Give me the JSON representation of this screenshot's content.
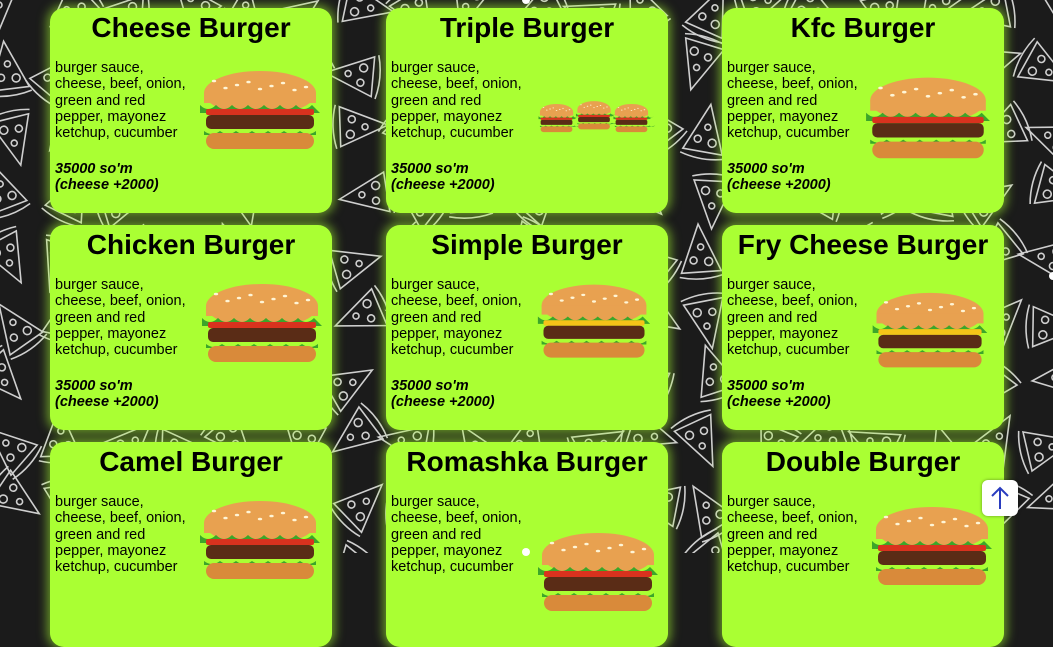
{
  "menu": {
    "items": [
      {
        "name": "Cheese Burger",
        "desc": "burger sauce, cheese, beef, onion, green and red pepper, mayonez ketchup, cucumber",
        "price": "35000 so'm",
        "extra": "(cheese +2000)"
      },
      {
        "name": "Triple Burger",
        "desc": "burger sauce, cheese, beef, onion, green and red pepper, mayonez ketchup, cucumber",
        "price": "35000 so'm",
        "extra": "(cheese +2000)"
      },
      {
        "name": "Kfc Burger",
        "desc": "burger sauce, cheese, beef, onion, green and red pepper, mayonez ketchup, cucumber",
        "price": "35000 so'm",
        "extra": "(cheese +2000)"
      },
      {
        "name": "Chicken Burger",
        "desc": "burger sauce, cheese, beef, onion, green and red pepper, mayonez ketchup, cucumber",
        "price": "35000 so'm",
        "extra": "(cheese +2000)"
      },
      {
        "name": "Simple Burger",
        "desc": "burger sauce, cheese, beef, onion, green and red pepper, mayonez ketchup, cucumber",
        "price": "35000 so'm",
        "extra": "(cheese +2000)"
      },
      {
        "name": "Fry Cheese Burger",
        "desc": "burger sauce, cheese, beef, onion, green and red pepper, mayonez ketchup, cucumber",
        "price": "35000 so'm",
        "extra": "(cheese +2000)"
      },
      {
        "name": "Camel Burger",
        "desc": "burger sauce, cheese, beef, onion, green and red pepper, mayonez ketchup, cucumber",
        "price": "",
        "extra": ""
      },
      {
        "name": "Romashka Burger",
        "desc": "burger sauce, cheese, beef, onion, green and red pepper, mayonez ketchup, cucumber",
        "price": "",
        "extra": ""
      },
      {
        "name": "Double Burger",
        "desc": "burger sauce, cheese, beef, onion, green and red pepper, mayonez ketchup, cucumber",
        "price": "",
        "extra": ""
      }
    ]
  },
  "scroll_top": {
    "icon": "arrow-up-icon"
  },
  "colors": {
    "card": "#aaff33",
    "background": "#1b1b1b",
    "pattern": "#d0d0d0"
  }
}
